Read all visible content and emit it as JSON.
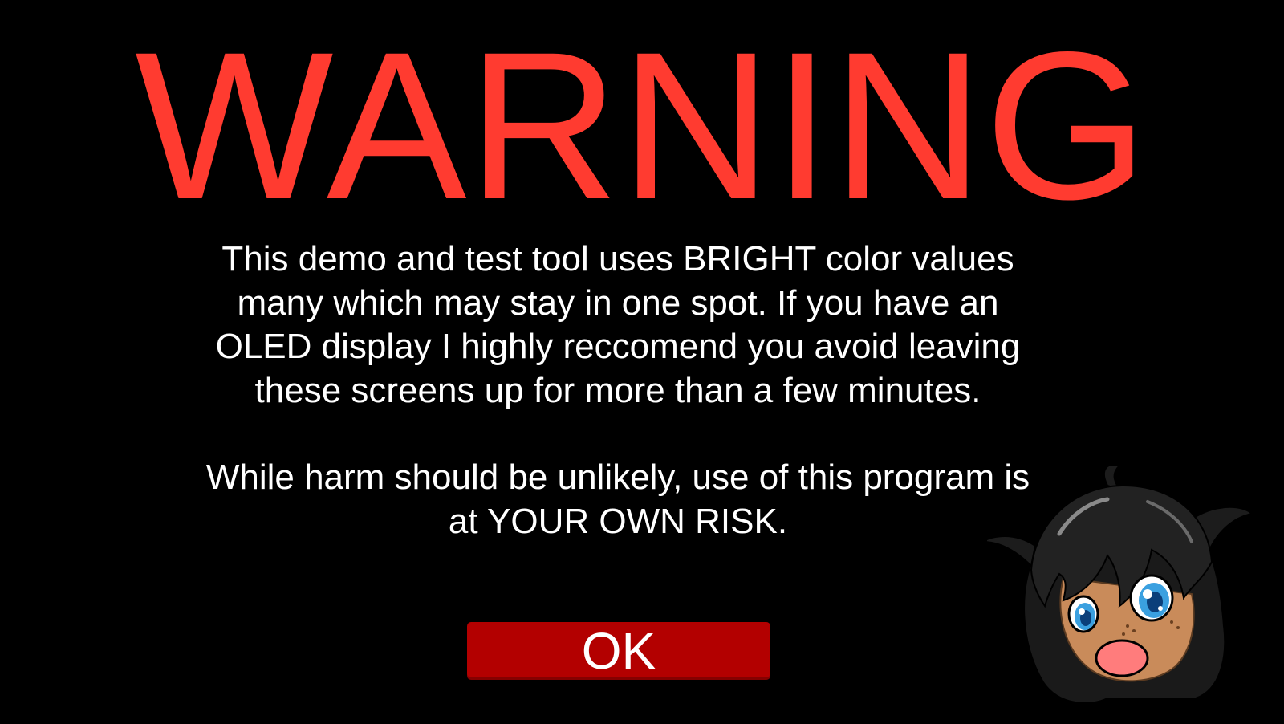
{
  "warning": {
    "title": "WARNING",
    "paragraph_1": "This demo and test tool uses BRIGHT color values many which may stay in one spot. If you have an OLED display I highly reccomend you avoid leaving these screens up for more than a few minutes.",
    "paragraph_2": "While harm should be unlikely, use of this program is at YOUR OWN RISK.",
    "ok_label": "OK"
  },
  "colors": {
    "background": "#000000",
    "title": "#ff3b30",
    "text": "#ffffff",
    "button": "#b30000"
  },
  "mascot": {
    "icon": "mascot-character-icon"
  }
}
